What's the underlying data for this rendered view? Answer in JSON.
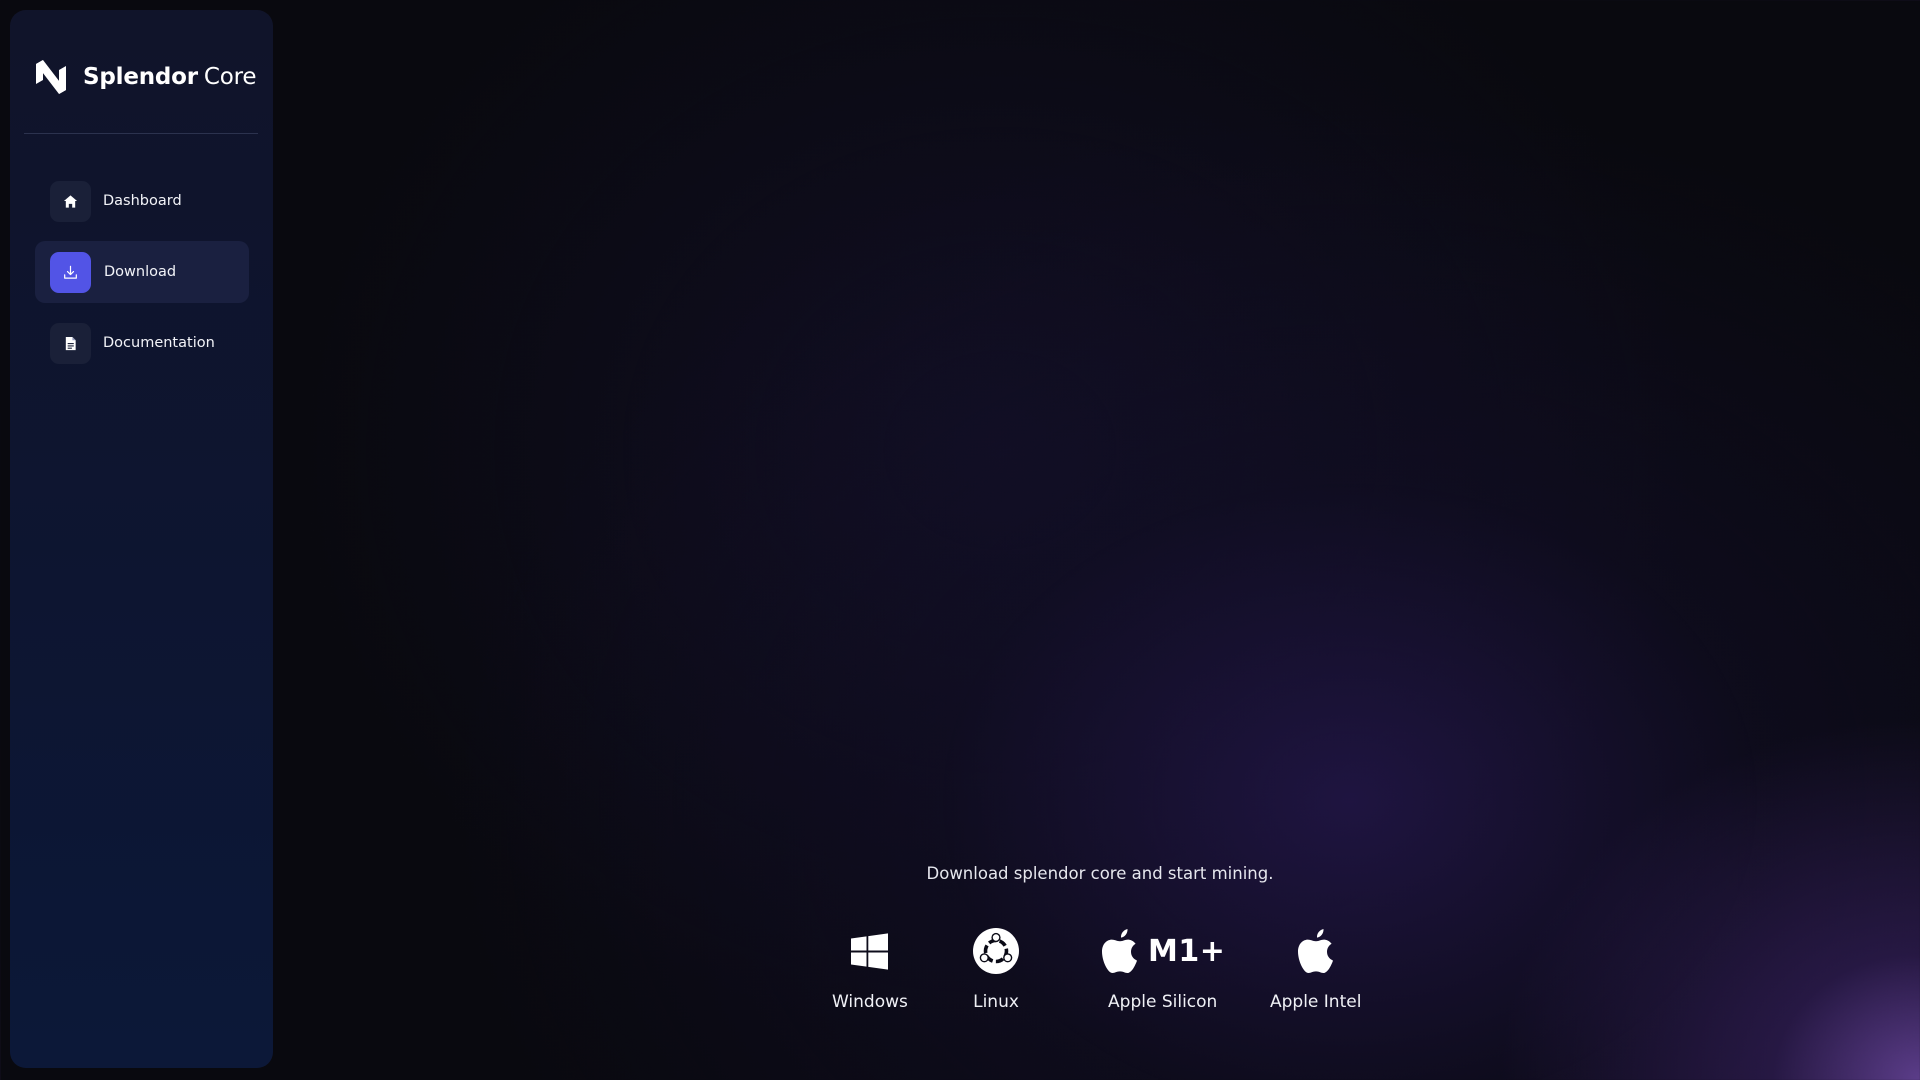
{
  "app": {
    "name_bold": "Splendor",
    "name_regular": "Core",
    "accent_color": "#5254e6"
  },
  "sidebar": {
    "items": [
      {
        "label": "Dashboard",
        "icon": "home-icon",
        "active": false
      },
      {
        "label": "Download",
        "icon": "download-icon",
        "active": true
      },
      {
        "label": "Documentation",
        "icon": "document-icon",
        "active": false
      }
    ]
  },
  "main": {
    "tagline": "Download splendor core and start mining.",
    "platforms": [
      {
        "label": "Windows",
        "icon": "windows-icon"
      },
      {
        "label": "Linux",
        "icon": "ubuntu-icon"
      },
      {
        "label": "Apple Silicon",
        "icon": "apple-icon",
        "badge": "M1+"
      },
      {
        "label": "Apple Intel",
        "icon": "apple-icon"
      }
    ]
  }
}
